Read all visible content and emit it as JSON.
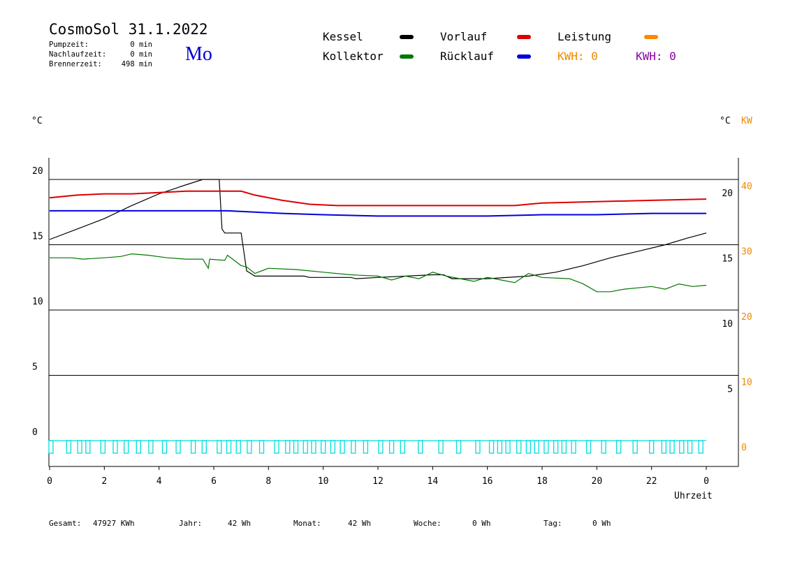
{
  "header": {
    "title": "CosmoSol 31.1.2022",
    "day": "Mo",
    "stats": [
      {
        "label": "Pumpzeit:",
        "value": "0 min"
      },
      {
        "label": "Nachlaufzeit:",
        "value": "0 min"
      },
      {
        "label": "Brennerzeit:",
        "value": "498 min"
      }
    ]
  },
  "legend": {
    "kessel": "Kessel",
    "kollektor": "Kollektor",
    "vorlauf": "Vorlauf",
    "ruecklauf": "Rücklauf",
    "leistung": "Leistung",
    "kwh1": "KWH: 0",
    "kwh2": "KWH: 0"
  },
  "axes": {
    "left_unit": "°C",
    "right_unit": "°C",
    "right_unit2": "KW",
    "xlabel": "Uhrzeit"
  },
  "colors": {
    "kessel": "#000000",
    "kollektor": "#007700",
    "vorlauf": "#dd0000",
    "ruecklauf": "#0000dd",
    "leistung": "#ff8800",
    "kwh1": "#ee8800",
    "kwh2": "#8800aa",
    "pump": "#00dddd"
  },
  "footer": [
    {
      "label": "Gesamt:",
      "value": "47927 KWh"
    },
    {
      "label": "Jahr:",
      "value": "42 Wh"
    },
    {
      "label": "Monat:",
      "value": "42 Wh"
    },
    {
      "label": "Woche:",
      "value": "0 Wh"
    },
    {
      "label": "Tag:",
      "value": "0 Wh"
    }
  ],
  "chart_data": {
    "type": "line",
    "xlabel": "Uhrzeit",
    "xlim": [
      0,
      24
    ],
    "ylim_left": [
      0,
      20
    ],
    "ylim_right_kw": [
      0,
      40
    ],
    "x_ticks": [
      "0",
      "2",
      "4",
      "6",
      "8",
      "10",
      "12",
      "14",
      "16",
      "18",
      "20",
      "22",
      "0"
    ],
    "y_ticks_left": [
      "0",
      "5",
      "10",
      "15",
      "20"
    ],
    "y_ticks_right_c": [
      "5",
      "10",
      "15",
      "20"
    ],
    "y_ticks_right_kw": [
      "0",
      "10",
      "20",
      "30",
      "40"
    ],
    "grid": true,
    "series": [
      {
        "name": "Kessel",
        "points": [
          [
            0,
            15.4
          ],
          [
            1,
            16.2
          ],
          [
            2,
            17.0
          ],
          [
            3,
            18.0
          ],
          [
            4,
            18.9
          ],
          [
            5,
            19.6
          ],
          [
            5.6,
            20.0
          ],
          [
            6.2,
            20.0
          ],
          [
            6.3,
            16.2
          ],
          [
            6.4,
            15.9
          ],
          [
            7.0,
            15.9
          ],
          [
            7.2,
            13.0
          ],
          [
            7.5,
            12.6
          ],
          [
            9.3,
            12.6
          ],
          [
            9.5,
            12.5
          ],
          [
            11.0,
            12.5
          ],
          [
            11.2,
            12.4
          ],
          [
            12.0,
            12.5
          ],
          [
            14.0,
            12.7
          ],
          [
            14.4,
            12.7
          ],
          [
            14.7,
            12.4
          ],
          [
            16.0,
            12.4
          ],
          [
            17.5,
            12.6
          ],
          [
            18.5,
            12.9
          ],
          [
            19.5,
            13.4
          ],
          [
            20.5,
            14.0
          ],
          [
            21.5,
            14.5
          ],
          [
            22.5,
            15.0
          ],
          [
            23.3,
            15.5
          ],
          [
            24.0,
            15.9
          ]
        ]
      },
      {
        "name": "Kollektor",
        "points": [
          [
            0,
            14.0
          ],
          [
            0.8,
            14.0
          ],
          [
            1.2,
            13.9
          ],
          [
            2.0,
            14.0
          ],
          [
            2.6,
            14.1
          ],
          [
            3.0,
            14.3
          ],
          [
            3.6,
            14.2
          ],
          [
            4.3,
            14.0
          ],
          [
            5.0,
            13.9
          ],
          [
            5.6,
            13.9
          ],
          [
            5.8,
            13.2
          ],
          [
            5.85,
            13.9
          ],
          [
            6.4,
            13.8
          ],
          [
            6.5,
            14.2
          ],
          [
            7.0,
            13.4
          ],
          [
            7.2,
            13.3
          ],
          [
            7.5,
            12.8
          ],
          [
            8.0,
            13.2
          ],
          [
            9.0,
            13.1
          ],
          [
            10.0,
            12.9
          ],
          [
            11.0,
            12.7
          ],
          [
            12.0,
            12.6
          ],
          [
            12.5,
            12.3
          ],
          [
            13.0,
            12.6
          ],
          [
            13.5,
            12.4
          ],
          [
            14.0,
            12.9
          ],
          [
            14.5,
            12.6
          ],
          [
            15.0,
            12.4
          ],
          [
            15.5,
            12.2
          ],
          [
            16.0,
            12.5
          ],
          [
            16.5,
            12.3
          ],
          [
            17.0,
            12.1
          ],
          [
            17.5,
            12.8
          ],
          [
            18.0,
            12.5
          ],
          [
            19.0,
            12.4
          ],
          [
            19.5,
            12.0
          ],
          [
            20.0,
            11.4
          ],
          [
            20.5,
            11.4
          ],
          [
            21.0,
            11.6
          ],
          [
            21.5,
            11.7
          ],
          [
            22.0,
            11.8
          ],
          [
            22.5,
            11.6
          ],
          [
            23.0,
            12.0
          ],
          [
            23.5,
            11.8
          ],
          [
            24.0,
            11.9
          ]
        ]
      },
      {
        "name": "Vorlauf",
        "points": [
          [
            0,
            18.6
          ],
          [
            1,
            18.8
          ],
          [
            2,
            18.9
          ],
          [
            3,
            18.9
          ],
          [
            4,
            19.0
          ],
          [
            5,
            19.1
          ],
          [
            7.0,
            19.1
          ],
          [
            7.5,
            18.8
          ],
          [
            8.5,
            18.4
          ],
          [
            9.5,
            18.1
          ],
          [
            10.5,
            18.0
          ],
          [
            12.0,
            18.0
          ],
          [
            14.0,
            18.0
          ],
          [
            16.0,
            18.0
          ],
          [
            17.0,
            18.0
          ],
          [
            18.0,
            18.2
          ],
          [
            20.0,
            18.3
          ],
          [
            22.0,
            18.4
          ],
          [
            24.0,
            18.5
          ]
        ]
      },
      {
        "name": "Rücklauf",
        "points": [
          [
            0,
            17.6
          ],
          [
            6.5,
            17.6
          ],
          [
            7.5,
            17.5
          ],
          [
            8.5,
            17.4
          ],
          [
            10.0,
            17.3
          ],
          [
            12.0,
            17.2
          ],
          [
            14.0,
            17.2
          ],
          [
            16.0,
            17.2
          ],
          [
            18.0,
            17.3
          ],
          [
            20.0,
            17.3
          ],
          [
            22.0,
            17.4
          ],
          [
            24.0,
            17.4
          ]
        ]
      },
      {
        "name": "Pumpe",
        "pulse_centers_h": [
          0.05,
          0.7,
          1.1,
          1.4,
          1.95,
          2.4,
          2.8,
          3.25,
          3.7,
          4.2,
          4.7,
          5.25,
          5.65,
          6.2,
          6.55,
          6.9,
          7.3,
          7.75,
          8.3,
          8.7,
          9.0,
          9.35,
          9.65,
          10.0,
          10.35,
          10.7,
          11.1,
          11.55,
          12.1,
          12.5,
          12.9,
          13.55,
          14.3,
          14.95,
          15.65,
          16.15,
          16.45,
          16.75,
          17.15,
          17.5,
          17.8,
          18.15,
          18.5,
          18.8,
          19.15,
          19.7,
          20.25,
          20.8,
          21.4,
          22.0,
          22.45,
          22.75,
          23.1,
          23.4,
          23.8
        ]
      }
    ]
  }
}
